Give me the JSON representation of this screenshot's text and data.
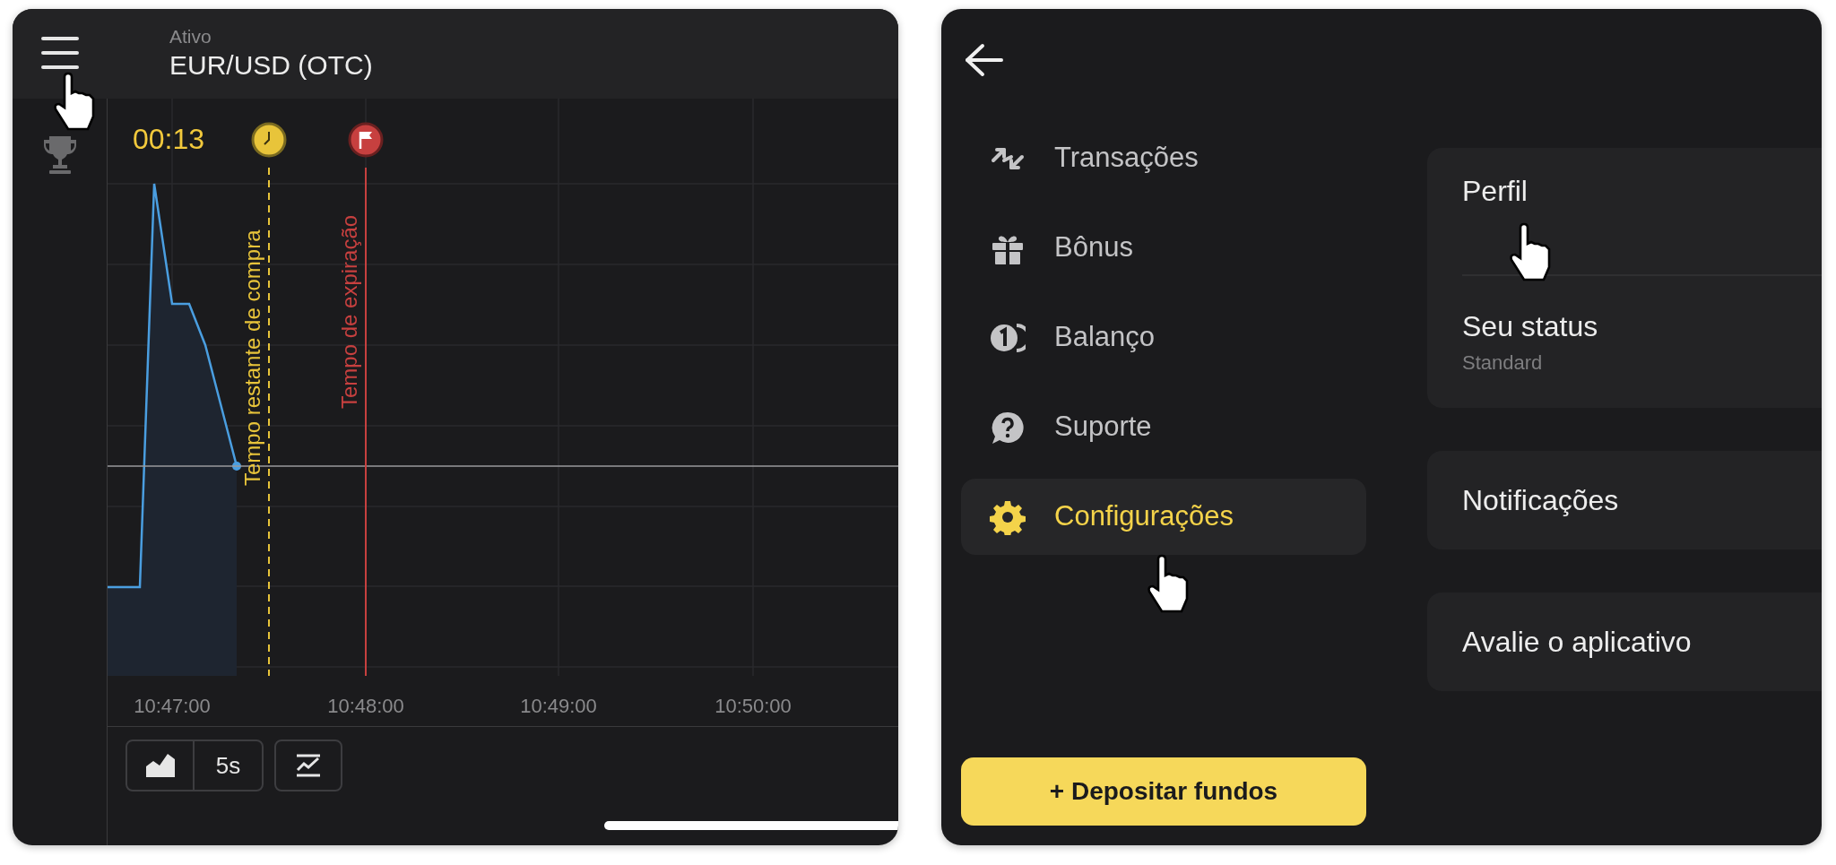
{
  "chart_panel": {
    "header": {
      "label": "Ativo",
      "asset": "EUR/USD (OTC)"
    },
    "timer": "00:13",
    "markers": [
      {
        "kind": "purchase",
        "label": "Tempo restante de compra",
        "color": "#e8c43a"
      },
      {
        "kind": "expiration",
        "label": "Tempo de expiração",
        "color": "#c7403f"
      }
    ],
    "time_axis": [
      "10:47:00",
      "10:48:00",
      "10:49:00",
      "10:50:00"
    ],
    "toolbar": {
      "interval": "5s"
    }
  },
  "menu_panel": {
    "items": [
      {
        "kind": "transactions",
        "label": "Transações",
        "selected": false
      },
      {
        "kind": "bonus",
        "label": "Bônus",
        "selected": false
      },
      {
        "kind": "balance",
        "label": "Balanço",
        "selected": false
      },
      {
        "kind": "support",
        "label": "Suporte",
        "selected": false
      },
      {
        "kind": "settings",
        "label": "Configurações",
        "selected": true
      }
    ],
    "deposit_button": "+ Depositar fundos"
  },
  "settings_cards": [
    {
      "rows": [
        {
          "title": "Perfil"
        },
        {
          "title": "Seu status",
          "subtitle": "Standard"
        }
      ]
    },
    {
      "rows": [
        {
          "title": "Notificações"
        }
      ]
    },
    {
      "rows": [
        {
          "title": "Avalie o aplicativo"
        }
      ]
    }
  ]
}
